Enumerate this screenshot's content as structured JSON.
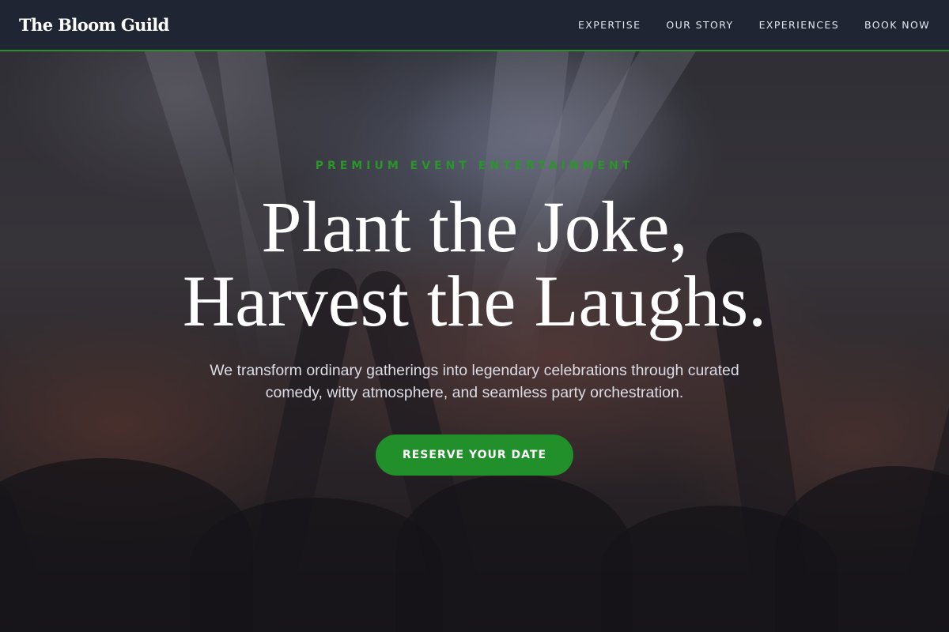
{
  "brand": {
    "name": "The Bloom Guild"
  },
  "nav": {
    "items": [
      {
        "label": "EXPERTISE"
      },
      {
        "label": "OUR STORY"
      },
      {
        "label": "EXPERIENCES"
      },
      {
        "label": "BOOK NOW"
      }
    ]
  },
  "hero": {
    "eyebrow": "PREMIUM EVENT ENTERTAINMENT",
    "headline_line1": "Plant the Joke,",
    "headline_line2": "Harvest the Laughs.",
    "subtext": "We transform ordinary gatherings into legendary celebrations through curated comedy, witty atmosphere, and seamless party orchestration.",
    "cta_label": "RESERVE YOUR DATE",
    "background_image": "concert-crowd-photo"
  },
  "colors": {
    "accent": "#22902a",
    "navbar_bg": "#1f2532",
    "navbar_border": "#2e8f2e",
    "text_primary": "#ffffff"
  }
}
